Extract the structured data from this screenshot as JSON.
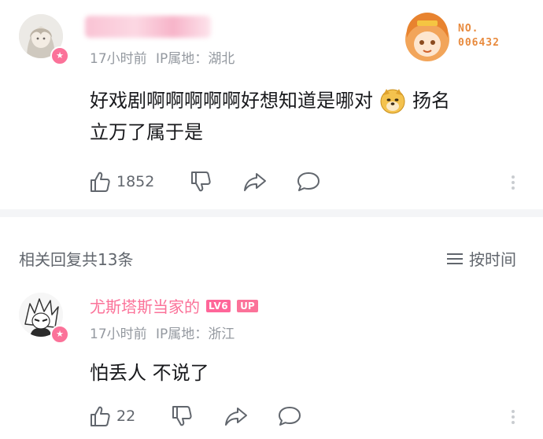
{
  "comment": {
    "time": "17小时前",
    "ip_label": "IP属地：",
    "ip_region": "湖北",
    "text_part1": "好戏剧啊啊啊啊啊好想知道是哪对",
    "emoji": "doge-emoji",
    "text_part2": "扬名",
    "text_line2": "立万了属于是",
    "like_count": "1852",
    "fan_badge": {
      "prefix": "NO.",
      "number": "006432"
    }
  },
  "replies_header": {
    "title": "相关回复共13条",
    "sort_label": "按时间"
  },
  "reply": {
    "username": "尤斯塔斯当家的",
    "level": "LV6",
    "up_tag": "UP",
    "time": "17小时前",
    "ip_label": "IP属地：",
    "ip_region": "浙江",
    "text": "怕丢人 不说了",
    "like_count": "22"
  },
  "colors": {
    "accent_pink": "#fb7299",
    "meta_gray": "#9499a0",
    "divider": "#f4f5f7"
  }
}
